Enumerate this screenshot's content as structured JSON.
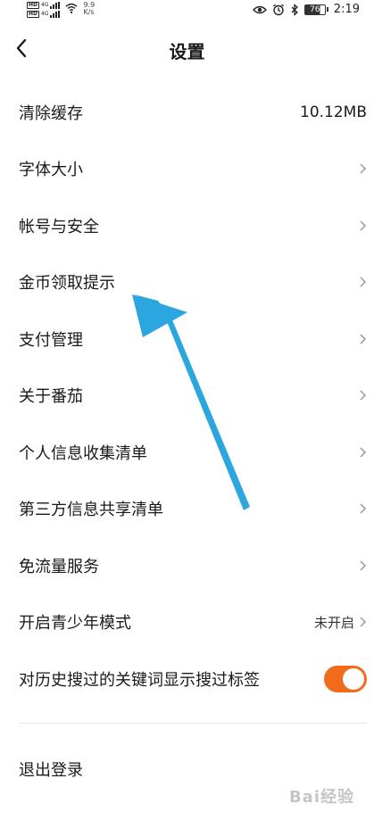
{
  "status_bar": {
    "sim1_hd": "HD",
    "sim1_net": "4G",
    "sim2_hd": "HD",
    "sim2_net": "4G",
    "speed_value": "9.9",
    "speed_unit": "K/s",
    "battery_level": "76",
    "time": "2:19"
  },
  "header": {
    "title": "设置"
  },
  "settings": {
    "items": [
      {
        "label": "清除缓存",
        "value": "10.12MB"
      },
      {
        "label": "字体大小"
      },
      {
        "label": "帐号与安全"
      },
      {
        "label": "金币领取提示"
      },
      {
        "label": "支付管理"
      },
      {
        "label": "关于番茄"
      },
      {
        "label": "个人信息收集清单"
      },
      {
        "label": "第三方信息共享清单"
      },
      {
        "label": "免流量服务"
      },
      {
        "label": "开启青少年模式",
        "value": "未开启"
      },
      {
        "label": "对历史搜过的关键词显示搜过标签",
        "toggle_on": true
      }
    ]
  },
  "logout": {
    "label": "退出登录"
  },
  "colors": {
    "toggle_on": "#f26a1b",
    "annotation_arrow": "#2ba6de"
  },
  "watermark": {
    "text": "Bai经验"
  }
}
